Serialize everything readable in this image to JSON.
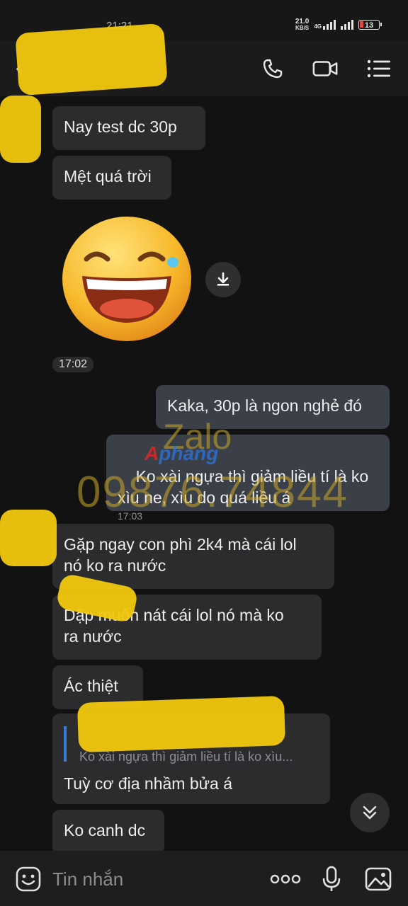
{
  "status_bar": {
    "time": "21:21",
    "net_speed_value": "21.0",
    "net_speed_unit": "KB/S",
    "network": "4G",
    "battery": "13"
  },
  "header": {
    "contact_name": "",
    "icons": [
      "back-arrow",
      "phone",
      "video-camera",
      "menu"
    ]
  },
  "messages": [
    {
      "side": "them",
      "text": "Nay test dc 30p"
    },
    {
      "side": "them",
      "text": "Mệt quá trời"
    },
    {
      "side": "them",
      "type": "sticker",
      "sticker": "laughing-tear-emoji"
    },
    {
      "side": "them",
      "text": "Kaka, 30p là ngon nghẻ đó",
      "me": true
    },
    {
      "side": "me",
      "text": "Ko xài ngựa thì giảm liều tí là ko xìu ne, xìu do quá liều á",
      "time": "17:03"
    },
    {
      "side": "them",
      "text": "Gặp ngay con phì 2k4 mà cái lol\nnó ko ra nước"
    },
    {
      "side": "them",
      "text": "Dập muốn nát cái lol nó mà ko\nra nước"
    },
    {
      "side": "them",
      "text": "Ác thiệt"
    },
    {
      "side": "them",
      "quote": "Ko xài ngựa thì giảm liều tí là ko xìu...",
      "text": "Tuỳ cơ địa nhầm bửa á"
    },
    {
      "side": "them",
      "text": "Ko canh dc"
    }
  ],
  "sticker_time": "17:02",
  "watermark": {
    "line1": "Zalo",
    "line2": "09876.74844",
    "logo_a": "A",
    "logo_b": "phang"
  },
  "input_bar": {
    "placeholder": "Tin nhắn"
  }
}
